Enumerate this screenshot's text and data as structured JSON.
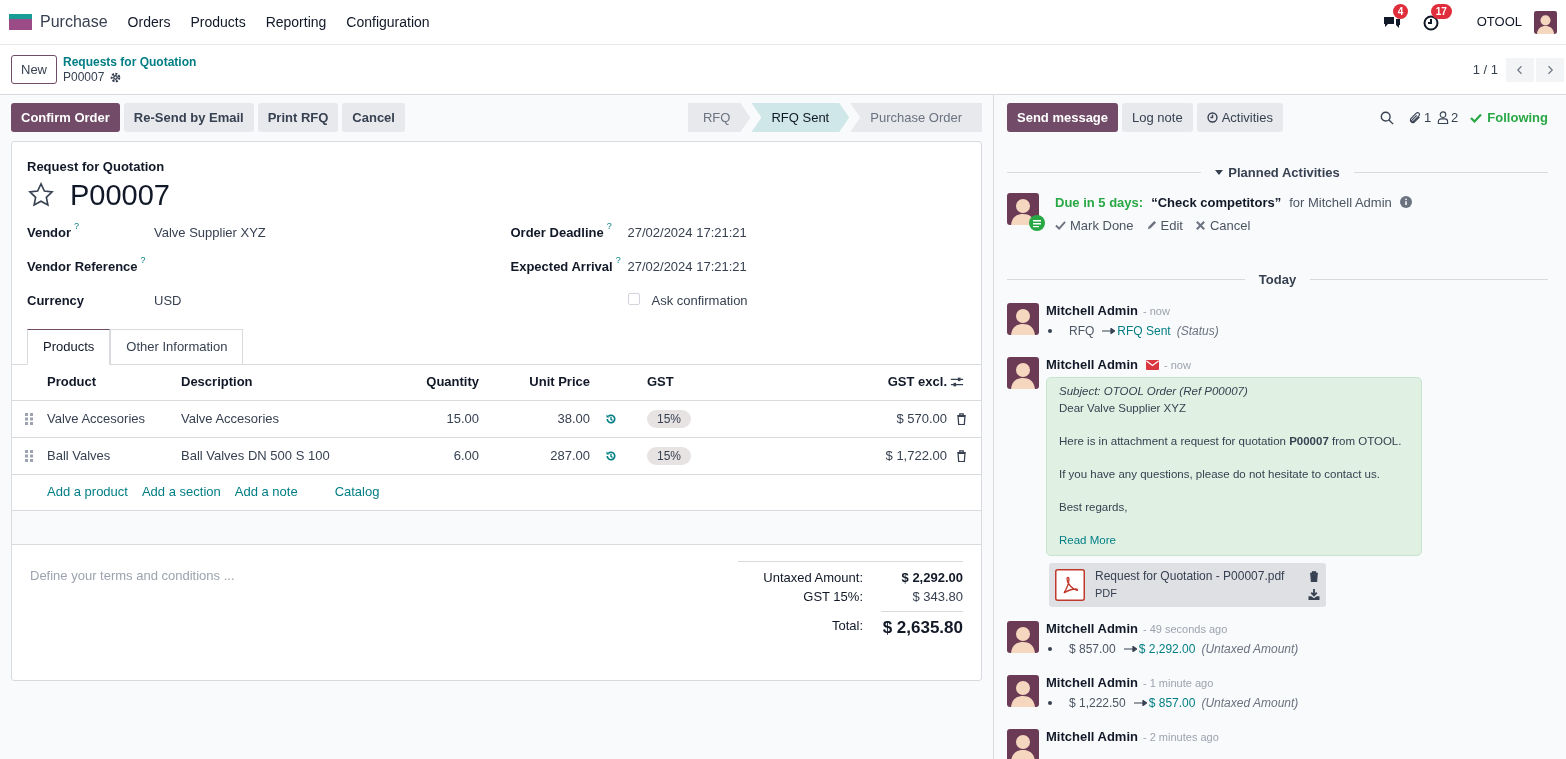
{
  "navbar": {
    "app": "Purchase",
    "menu": [
      "Orders",
      "Products",
      "Reporting",
      "Configuration"
    ],
    "messages_count": "4",
    "activities_count": "17",
    "company": "OTOOL"
  },
  "control_panel": {
    "new_button": "New",
    "breadcrumb": "Requests for Quotation",
    "record": "P00007",
    "pager": "1 / 1"
  },
  "action_buttons": [
    {
      "label": "Confirm Order",
      "primary": true
    },
    {
      "label": "Re-Send by Email",
      "primary": false
    },
    {
      "label": "Print RFQ",
      "primary": false
    },
    {
      "label": "Cancel",
      "primary": false
    }
  ],
  "statusbar": [
    {
      "label": "RFQ",
      "selected": false
    },
    {
      "label": "RFQ Sent",
      "selected": true
    },
    {
      "label": "Purchase Order",
      "selected": false
    }
  ],
  "form": {
    "subtitle": "Request for Quotation",
    "name": "P00007",
    "starred": false,
    "left_fields": [
      {
        "label": "Vendor",
        "help": "?",
        "value": "Valve Supplier XYZ"
      },
      {
        "label": "Vendor Reference",
        "help": "?"
      },
      {
        "label": "Currency",
        "value": "USD"
      }
    ],
    "right_fields": [
      {
        "kind": "text",
        "label": "Order Deadline",
        "help": "?",
        "value": "27/02/2024 17:21:21"
      },
      {
        "kind": "text",
        "label": "Expected Arrival",
        "help": "?",
        "value": "27/02/2024 17:21:21"
      },
      {
        "kind": "checkbox",
        "label": "Ask confirmation",
        "checked": false
      }
    ],
    "tabs": [
      {
        "label": "Products",
        "selected": true
      },
      {
        "label": "Other Information",
        "selected": false
      }
    ],
    "table": {
      "columns": [
        "Product",
        "Description",
        "Quantity",
        "Unit Price",
        "GST",
        "GST excl."
      ],
      "rows": [
        {
          "product": "Valve Accesories",
          "description": "Valve Accesories",
          "quantity": "15.00",
          "unit_price": "38.00",
          "tax": "15%",
          "subtotal": "$ 570.00"
        },
        {
          "product": "Ball Valves",
          "description": "Ball Valves DN 500 S 100",
          "quantity": "6.00",
          "unit_price": "287.00",
          "tax": "15%",
          "subtotal": "$ 1,722.00"
        }
      ]
    },
    "add_links": [
      "Add a product",
      "Add a section",
      "Add a note",
      "Catalog"
    ],
    "terms_placeholder": "Define your terms and conditions ...",
    "totals": [
      {
        "kind": "untaxed",
        "label": "Untaxed Amount:",
        "value": "$ 2,292.00"
      },
      {
        "kind": "tax",
        "label": "GST 15%:",
        "value": "$ 343.80"
      },
      {
        "kind": "total",
        "label": "Total:",
        "value": "$ 2,635.80"
      }
    ]
  },
  "chatter": {
    "buttons": [
      {
        "label": "Send message",
        "primary": true
      },
      {
        "label": "Log note",
        "primary": false
      },
      {
        "label": "Activities",
        "primary": false
      }
    ],
    "attachments_count": "1",
    "followers_count": "2",
    "follow_label": "Following",
    "planned_heading": "Planned Activities",
    "activity": {
      "due": "Due in 5 days:",
      "summary": "“Check competitors”",
      "assignee": "for Mitchell Admin",
      "actions": [
        "Mark Done",
        "Edit",
        "Cancel"
      ]
    },
    "date_separator": "Today",
    "messages": [
      {
        "kind": "tracking",
        "author": "Mitchell Admin",
        "time": "- now",
        "old": "RFQ",
        "new": "RFQ Sent",
        "field": "(Status)"
      },
      {
        "kind": "email",
        "author": "Mitchell Admin",
        "time": "- now",
        "body": [
          {
            "kind": "subject",
            "text": "Subject: OTOOL Order (Ref P00007)"
          },
          {
            "kind": "line",
            "text": "Dear Valve Supplier XYZ"
          },
          {
            "kind": "para",
            "text": "Here is in attachment a request for quotation **P00007** from OTOOL."
          },
          {
            "kind": "para",
            "text": "If you have any questions, please do not hesitate to contact us."
          },
          {
            "kind": "para",
            "text": "Best regards,"
          }
        ],
        "read_more": "Read More",
        "attachment": {
          "name": "Request for Quotation - P00007.pdf",
          "type": "PDF"
        }
      },
      {
        "kind": "tracking",
        "author": "Mitchell Admin",
        "time": "- 49 seconds ago",
        "old": "$ 857.00",
        "new": "$ 2,292.00",
        "field": "(Untaxed Amount)"
      },
      {
        "kind": "tracking",
        "author": "Mitchell Admin",
        "time": "- 1 minute ago",
        "old": "$ 1,222.50",
        "new": "$ 857.00",
        "field": "(Untaxed Amount)"
      },
      {
        "kind": "header",
        "author": "Mitchell Admin",
        "time": "- 2 minutes ago"
      }
    ]
  }
}
